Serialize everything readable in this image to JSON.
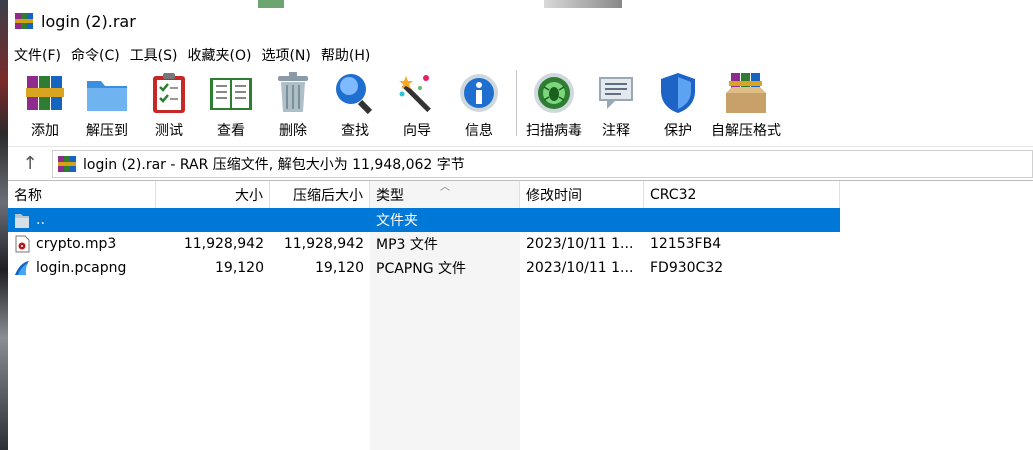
{
  "window": {
    "title": "login (2).rar"
  },
  "menu": [
    "文件(F)",
    "命令(C)",
    "工具(S)",
    "收藏夹(O)",
    "选项(N)",
    "帮助(H)"
  ],
  "toolbar": {
    "add": "添加",
    "extract": "解压到",
    "test": "测试",
    "view": "查看",
    "delete": "删除",
    "find": "查找",
    "wizard": "向导",
    "info": "信息",
    "virus": "扫描病毒",
    "comment": "注释",
    "protect": "保护",
    "sfx": "自解压格式"
  },
  "address": {
    "text": "login (2).rar - RAR 压缩文件, 解包大小为 11,948,062 字节"
  },
  "columns": {
    "name": "名称",
    "size": "大小",
    "packed": "压缩后大小",
    "type": "类型",
    "modified": "修改时间",
    "crc": "CRC32"
  },
  "rows": [
    {
      "name": "..",
      "size": "",
      "packed": "",
      "type": "文件夹",
      "modified": "",
      "crc": ""
    },
    {
      "name": "crypto.mp3",
      "size": "11,928,942",
      "packed": "11,928,942",
      "type": "MP3 文件",
      "modified": "2023/10/11 1...",
      "crc": "12153FB4"
    },
    {
      "name": "login.pcapng",
      "size": "19,120",
      "packed": "19,120",
      "type": "PCAPNG 文件",
      "modified": "2023/10/11 1...",
      "crc": "FD930C32"
    }
  ]
}
